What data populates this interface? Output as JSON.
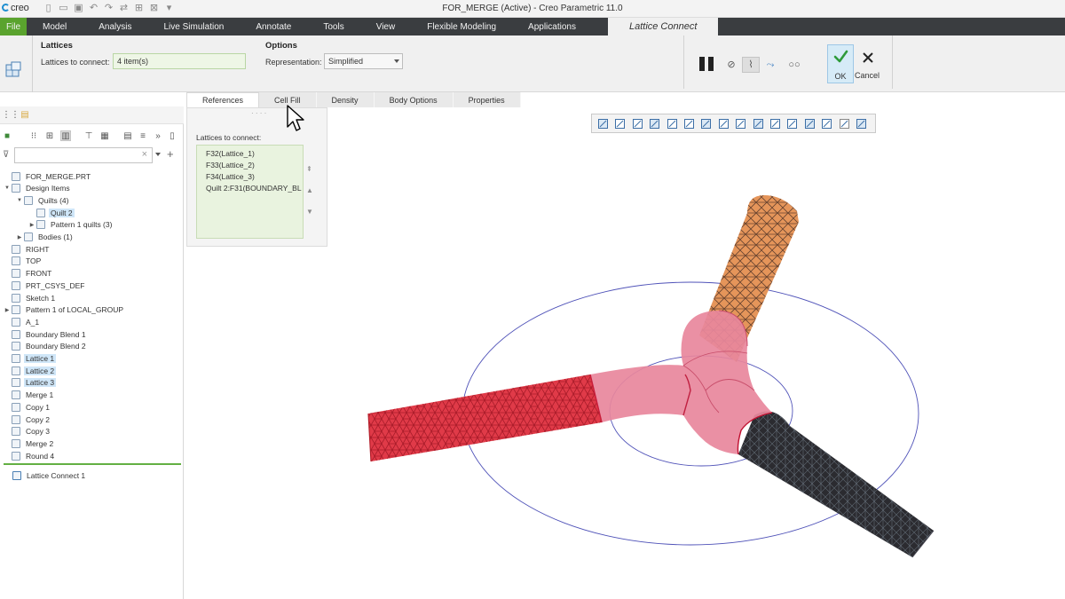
{
  "app": {
    "logo_text": "creo",
    "window_title": "FOR_MERGE (Active) - Creo Parametric 11.0"
  },
  "quick_access": [
    {
      "name": "new-icon",
      "glyph": "▯"
    },
    {
      "name": "open-icon",
      "glyph": "▭"
    },
    {
      "name": "save-icon",
      "glyph": "▣"
    },
    {
      "name": "undo-icon",
      "glyph": "↶"
    },
    {
      "name": "redo-icon",
      "glyph": "↷"
    },
    {
      "name": "regenerate-icon",
      "glyph": "⇄"
    },
    {
      "name": "windows-icon",
      "glyph": "⊞"
    },
    {
      "name": "close-window-icon",
      "glyph": "⊠"
    },
    {
      "name": "customize-qat-icon",
      "glyph": "▾"
    }
  ],
  "menu": {
    "file": "File",
    "tabs": [
      "Model",
      "Analysis",
      "Live Simulation",
      "Annotate",
      "Tools",
      "View",
      "Flexible Modeling",
      "Applications"
    ],
    "active_tab": "Lattice Connect"
  },
  "dashboard": {
    "lattices_group": "Lattices",
    "lattices_to_connect_label": "Lattices to connect:",
    "lattices_to_connect_value": "4 item(s)",
    "options_group": "Options",
    "representation_label": "Representation:",
    "representation_value": "Simplified",
    "ok_label": "OK",
    "cancel_label": "Cancel"
  },
  "subtabs": [
    "References",
    "Cell Fill",
    "Density",
    "Body Options",
    "Properties"
  ],
  "active_subtab": "References",
  "reference_panel": {
    "title": "Lattices to connect:",
    "items": [
      "F32(Lattice_1)",
      "F33(Lattice_2)",
      "F34(Lattice_3)",
      "Quilt 2:F31(BOUNDARY_BL"
    ]
  },
  "model_tree": {
    "items": [
      {
        "label": "FOR_MERGE.PRT",
        "level": 0,
        "twisty": "",
        "selected": false,
        "icon": "part-icon"
      },
      {
        "label": "Design Items",
        "level": 0,
        "twisty": "▼",
        "selected": false,
        "icon": "design-items-icon"
      },
      {
        "label": "Quilts (4)",
        "level": 1,
        "twisty": "▼",
        "selected": false,
        "icon": "quilts-icon"
      },
      {
        "label": "Quilt 2",
        "level": 2,
        "twisty": "",
        "selected": true,
        "icon": "quilt-icon"
      },
      {
        "label": "Pattern 1 quilts (3)",
        "level": 2,
        "twisty": "▶",
        "selected": false,
        "icon": "pattern-icon"
      },
      {
        "label": "Bodies (1)",
        "level": 1,
        "twisty": "▶",
        "selected": false,
        "icon": "bodies-icon"
      },
      {
        "label": "RIGHT",
        "level": 0,
        "twisty": "",
        "selected": false,
        "icon": "datum-plane-icon"
      },
      {
        "label": "TOP",
        "level": 0,
        "twisty": "",
        "selected": false,
        "icon": "datum-plane-icon"
      },
      {
        "label": "FRONT",
        "level": 0,
        "twisty": "",
        "selected": false,
        "icon": "datum-plane-icon"
      },
      {
        "label": "PRT_CSYS_DEF",
        "level": 0,
        "twisty": "",
        "selected": false,
        "icon": "csys-icon"
      },
      {
        "label": "Sketch 1",
        "level": 0,
        "twisty": "",
        "selected": false,
        "icon": "sketch-icon"
      },
      {
        "label": "Pattern 1 of LOCAL_GROUP",
        "level": 0,
        "twisty": "▶",
        "selected": false,
        "icon": "pattern-icon"
      },
      {
        "label": "A_1",
        "level": 0,
        "twisty": "",
        "selected": false,
        "icon": "axis-icon"
      },
      {
        "label": "Boundary Blend 1",
        "level": 0,
        "twisty": "",
        "selected": false,
        "icon": "boundary-blend-icon"
      },
      {
        "label": "Boundary Blend 2",
        "level": 0,
        "twisty": "",
        "selected": false,
        "icon": "boundary-blend-icon"
      },
      {
        "label": "Lattice 1",
        "level": 0,
        "twisty": "",
        "selected": true,
        "icon": "lattice-icon"
      },
      {
        "label": "Lattice 2",
        "level": 0,
        "twisty": "",
        "selected": true,
        "icon": "lattice-icon"
      },
      {
        "label": "Lattice 3",
        "level": 0,
        "twisty": "",
        "selected": true,
        "icon": "lattice-icon"
      },
      {
        "label": "Merge 1",
        "level": 0,
        "twisty": "",
        "selected": false,
        "icon": "merge-icon"
      },
      {
        "label": "Copy 1",
        "level": 0,
        "twisty": "",
        "selected": false,
        "icon": "copy-icon"
      },
      {
        "label": "Copy 2",
        "level": 0,
        "twisty": "",
        "selected": false,
        "icon": "copy-icon"
      },
      {
        "label": "Copy 3",
        "level": 0,
        "twisty": "",
        "selected": false,
        "icon": "copy-icon"
      },
      {
        "label": "Merge 2",
        "level": 0,
        "twisty": "",
        "selected": false,
        "icon": "merge-icon"
      },
      {
        "label": "Round 4",
        "level": 0,
        "twisty": "",
        "selected": false,
        "icon": "round-icon"
      }
    ],
    "insert_item": "Lattice Connect 1"
  },
  "colors": {
    "menubar_bg": "#3a3d40",
    "file_tab_green": "#5aa32e",
    "selection_blue": "#cfe6f8",
    "lattice_red": "#e03a48",
    "lattice_orange": "#e5955a",
    "lattice_dark": "#2b2b30",
    "connect_pink": "#e8879c",
    "ok_green": "#2e9a3a"
  }
}
